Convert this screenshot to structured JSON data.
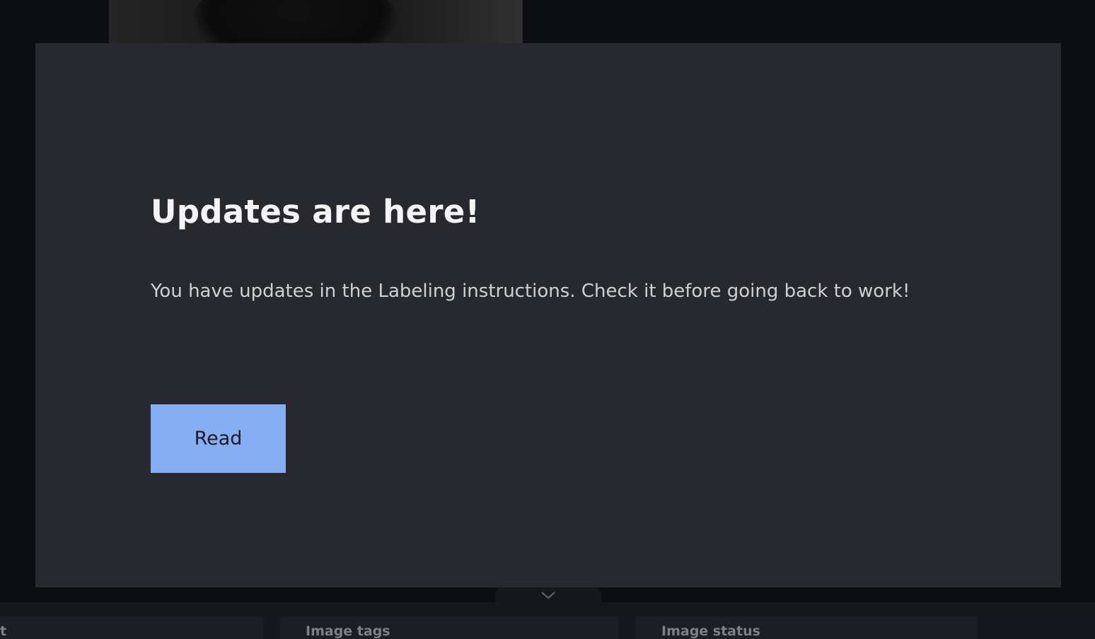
{
  "modal": {
    "title": "Updates are here!",
    "message": "You have updates in the Labeling instructions. Check it before going back to work!",
    "read_button_label": "Read"
  },
  "bottom_panel": {
    "left_label": "t",
    "image_tags_label": "Image tags",
    "image_status_label": "Image status",
    "collapse_icon": "chevron-down-icon"
  },
  "colors": {
    "modal_background": "#28292e",
    "primary_button": "#86aef2",
    "page_background": "#0c0e12"
  }
}
